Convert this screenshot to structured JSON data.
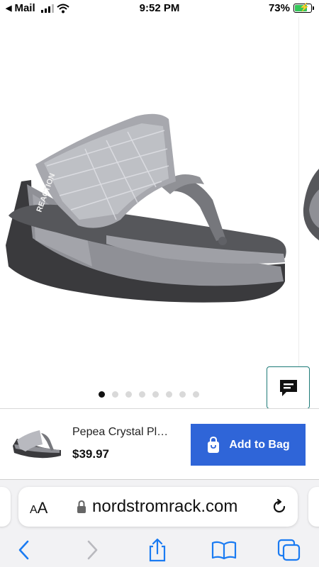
{
  "status_bar": {
    "back_app": "Mail",
    "time": "9:52 PM",
    "battery": "73%",
    "icons": [
      "back-arrow-icon",
      "cellular-signal-icon",
      "wifi-icon",
      "battery-charging-icon"
    ]
  },
  "gallery": {
    "image_count": 8,
    "active_index": 0,
    "image_subject": "silver wedge thong sandal with crystal strap",
    "strap_branding": "REACTION"
  },
  "chat": {
    "icon": "chat-bubble-icon"
  },
  "product": {
    "name": "Pepea Crystal Pl…",
    "price": "$39.97",
    "add_to_bag_label": "Add to Bag",
    "add_to_bag_icon": "shopping-bag-icon"
  },
  "browser": {
    "text_size_label_small": "A",
    "text_size_label_large": "A",
    "url": "nordstromrack.com",
    "icons": [
      "lock-icon",
      "reload-icon",
      "back-icon",
      "forward-icon",
      "share-icon",
      "bookmarks-icon",
      "tabs-icon"
    ]
  },
  "colors": {
    "add_to_bag_bg": "#2f65d8",
    "chat_border": "#1d7a77",
    "battery_fill": "#34c759",
    "safari_blue": "#1a7bf2"
  }
}
